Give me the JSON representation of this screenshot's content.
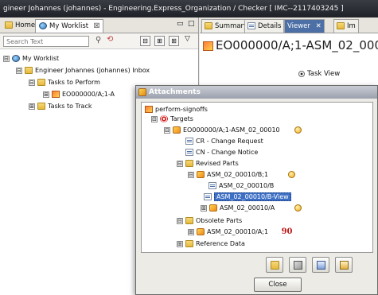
{
  "window": {
    "title": "gineer Johannes (johannes) - Engineering.Express_Organization / Checker  [ IMC--2117403245 ]"
  },
  "left_panel": {
    "tabs": [
      {
        "label": "Home"
      },
      {
        "label": "My Worklist"
      }
    ],
    "tab_close_glyph": "☒",
    "search": {
      "placeholder": "Search Text"
    },
    "toolbar_glyphs": [
      "⊟",
      "⊞",
      "⊞",
      "▽"
    ],
    "tree": [
      {
        "label": "My Worklist",
        "toggle": "⊟"
      },
      {
        "label": "Engineer Johannes (johannes) Inbox",
        "toggle": "⊟"
      },
      {
        "label": "Tasks to Perform",
        "toggle": "⊟"
      },
      {
        "label": "EO000000/A;1-A",
        "toggle": "⊞"
      },
      {
        "label": "Tasks to Track",
        "toggle": "⊞"
      }
    ]
  },
  "right_panel": {
    "tabs": [
      {
        "label": "Summary"
      },
      {
        "label": "Details"
      },
      {
        "label": "Viewer"
      },
      {
        "label": "Im"
      }
    ],
    "viewer_close_glyph": "✕",
    "object_header": "EO000000/A;1-ASM_02_000",
    "task_view_label": "Task View"
  },
  "dialog": {
    "title": "Attachments",
    "tree": [
      {
        "label": "perform-signoffs",
        "toggle": ""
      },
      {
        "label": "Targets",
        "toggle": "⊟"
      },
      {
        "label": "EO000000/A;1-ASM_02_00010",
        "toggle": "⊟"
      },
      {
        "label": "CR - Change Request",
        "toggle": ""
      },
      {
        "label": "CN - Change Notice",
        "toggle": ""
      },
      {
        "label": "Revised Parts",
        "toggle": "⊟"
      },
      {
        "label": "ASM_02_00010/B;1",
        "toggle": "⊟"
      },
      {
        "label": "ASM_02_00010/B",
        "toggle": ""
      },
      {
        "label": "ASM_02_00010/B-View",
        "toggle": ""
      },
      {
        "label": "ASM_02_00010/A",
        "toggle": "⊞"
      },
      {
        "label": "Obsolete Parts",
        "toggle": "⊟"
      },
      {
        "label": "ASM_02_00010/A;1",
        "toggle": "⊞"
      },
      {
        "label": "Reference Data",
        "toggle": "⊞"
      }
    ],
    "obsolete_marker": "90",
    "close_label": "Close"
  },
  "colors": {
    "selection": "#3d6fc4",
    "viewer_tab": "#4c6fa6",
    "obsolete_marker": "#c01818"
  }
}
